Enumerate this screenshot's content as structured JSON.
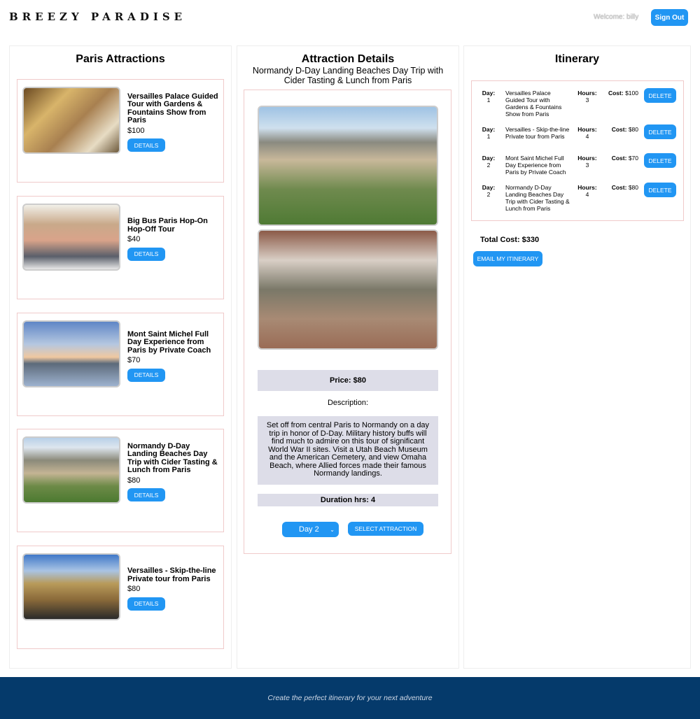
{
  "header": {
    "logo": "BREEZY PARADISE",
    "welcome": "Welcome: billy",
    "sign_out": "Sign Out"
  },
  "attractions": {
    "title": "Paris Attractions",
    "details_label": "DETAILS",
    "items": [
      {
        "name": "Versailles Palace Guided Tour with Gardens & Fountains Show from Paris",
        "price": "$100"
      },
      {
        "name": "Big Bus Paris Hop-On Hop-Off Tour",
        "price": "$40"
      },
      {
        "name": "Mont Saint Michel Full Day Experience from Paris by Private Coach",
        "price": "$70"
      },
      {
        "name": "Normandy D-Day Landing Beaches Day Trip with Cider Tasting & Lunch from Paris",
        "price": "$80"
      },
      {
        "name": "Versailles - Skip-the-line Private tour from Paris",
        "price": "$80"
      }
    ]
  },
  "details": {
    "title": "Attraction Details",
    "name": "Normandy D-Day Landing Beaches Day Trip with Cider Tasting & Lunch from Paris",
    "price": "Price: $80",
    "description_label": "Description:",
    "description": "Set off from central Paris to Normandy on a day trip in honor of D-Day. Military history buffs will find much to admire on this tour of significant World War II sites. Visit a Utah Beach Museum and the American Cemetery, and view Omaha Beach, where Allied forces made their famous Normandy landings.",
    "duration": "Duration hrs: 4",
    "day_select": "Day 2",
    "select_label": "SELECT ATTRACTION"
  },
  "itinerary": {
    "title": "Itinerary",
    "day_label": "Day:",
    "hours_label": "Hours:",
    "cost_label": "Cost:",
    "delete_label": "DELETE",
    "items": [
      {
        "day": "1",
        "name": "Versailles Palace Guided Tour with Gardens & Fountains Show from Paris",
        "hours": "3",
        "cost": "$100"
      },
      {
        "day": "1",
        "name": "Versailles - Skip-the-line Private tour from Paris",
        "hours": "4",
        "cost": "$80"
      },
      {
        "day": "2",
        "name": "Mont Saint Michel Full Day Experience from Paris by Private Coach",
        "hours": "3",
        "cost": "$70"
      },
      {
        "day": "2",
        "name": "Normandy D-Day Landing Beaches Day Trip with Cider Tasting & Lunch from Paris",
        "hours": "4",
        "cost": "$80"
      }
    ],
    "total": "Total Cost: $330",
    "email_label": "EMAIL MY ITINERARY"
  },
  "footer": {
    "tagline": "Create the perfect itinerary for your next adventure"
  },
  "colors": {
    "accent": "#2196f3",
    "footer": "#053a6b",
    "info_bar": "#dddde8"
  }
}
